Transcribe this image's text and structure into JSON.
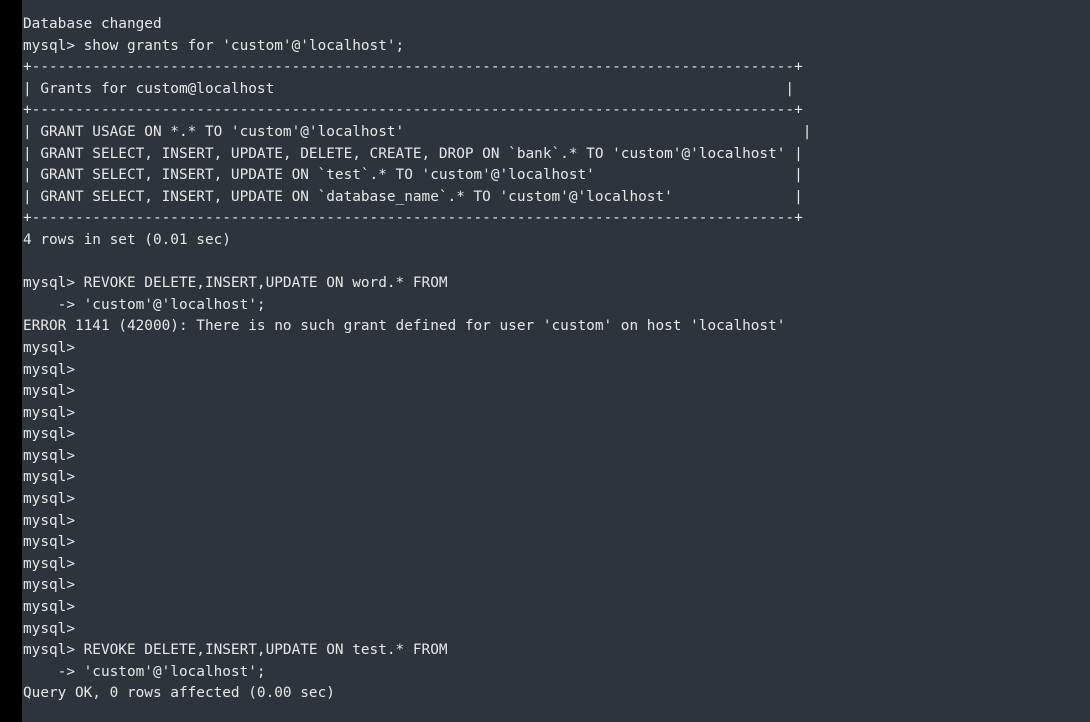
{
  "terminal": {
    "lines": [
      "Database changed",
      "mysql> show grants for 'custom'@'localhost';",
      "+----------------------------------------------------------------------------------------+",
      "| Grants for custom@localhost                                                           |",
      "+----------------------------------------------------------------------------------------+",
      "| GRANT USAGE ON *.* TO 'custom'@'localhost'                                              |",
      "| GRANT SELECT, INSERT, UPDATE, DELETE, CREATE, DROP ON `bank`.* TO 'custom'@'localhost' |",
      "| GRANT SELECT, INSERT, UPDATE ON `test`.* TO 'custom'@'localhost'                       |",
      "| GRANT SELECT, INSERT, UPDATE ON `database_name`.* TO 'custom'@'localhost'              |",
      "+----------------------------------------------------------------------------------------+",
      "4 rows in set (0.01 sec)",
      "",
      "mysql> REVOKE DELETE,INSERT,UPDATE ON word.* FROM",
      "    -> 'custom'@'localhost';",
      "ERROR 1141 (42000): There is no such grant defined for user 'custom' on host 'localhost'",
      "mysql>",
      "mysql>",
      "mysql>",
      "mysql>",
      "mysql>",
      "mysql>",
      "mysql>",
      "mysql>",
      "mysql>",
      "mysql>",
      "mysql>",
      "mysql>",
      "mysql>",
      "mysql>",
      "mysql> REVOKE DELETE,INSERT,UPDATE ON test.* FROM",
      "    -> 'custom'@'localhost';",
      "Query OK, 0 rows affected (0.00 sec)"
    ]
  }
}
